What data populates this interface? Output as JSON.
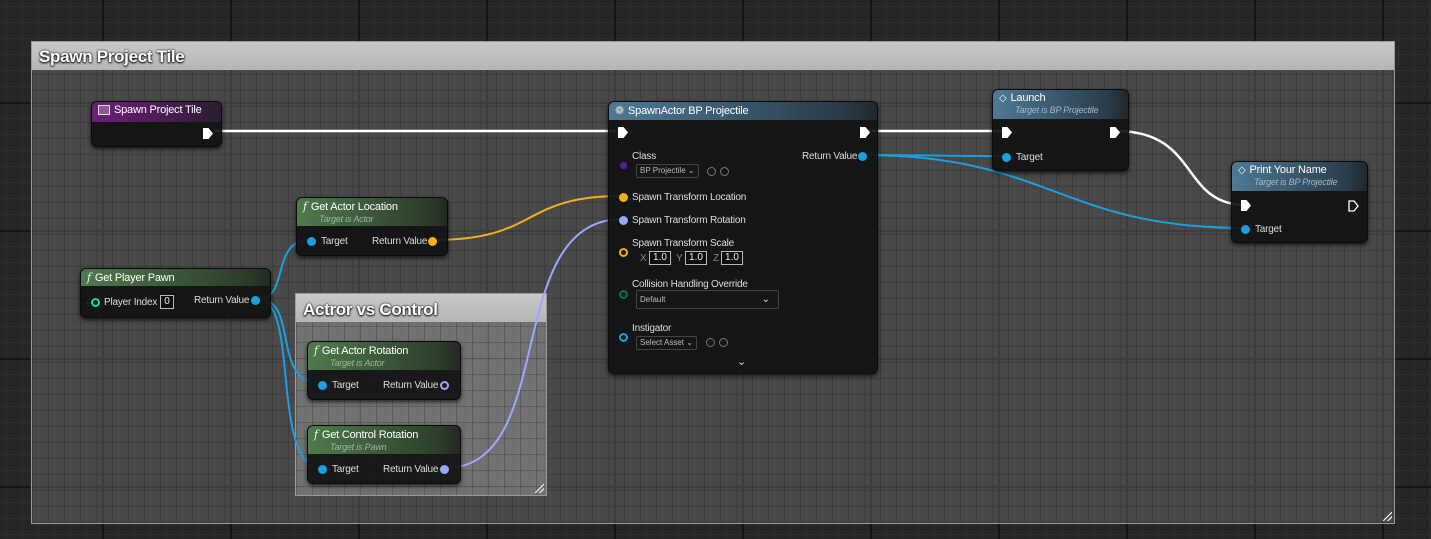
{
  "comments": {
    "main": {
      "title": "Spawn Project Tile"
    },
    "inner": {
      "title": "Actror vs Control"
    }
  },
  "nodes": {
    "event": {
      "title": "Spawn Project Tile"
    },
    "get_player_pawn": {
      "title": "Get Player Pawn",
      "player_index_label": "Player Index",
      "player_index_value": "0",
      "return_label": "Return Value"
    },
    "get_actor_location": {
      "title": "Get Actor Location",
      "subtitle": "Target is Actor",
      "target_label": "Target",
      "return_label": "Return Value"
    },
    "get_actor_rotation": {
      "title": "Get Actor Rotation",
      "subtitle": "Target is Actor",
      "target_label": "Target",
      "return_label": "Return Value"
    },
    "get_control_rotation": {
      "title": "Get Control Rotation",
      "subtitle": "Target is Pawn",
      "target_label": "Target",
      "return_label": "Return Value"
    },
    "spawn_actor": {
      "title": "SpawnActor BP Projectile",
      "class_label": "Class",
      "class_value": "BP Projectile",
      "return_label": "Return Value",
      "loc_label": "Spawn Transform Location",
      "rot_label": "Spawn Transform Rotation",
      "scale_label": "Spawn Transform Scale",
      "scale_x_label": "X",
      "scale_x": "1.0",
      "scale_y_label": "Y",
      "scale_y": "1.0",
      "scale_z_label": "Z",
      "scale_z": "1.0",
      "collision_label": "Collision Handling Override",
      "collision_value": "Default",
      "instigator_label": "Instigator",
      "instigator_value": "Select Asset"
    },
    "launch": {
      "title": "Launch",
      "subtitle": "Target is BP Projectile",
      "target_label": "Target"
    },
    "print_name": {
      "title": "Print Your Name",
      "subtitle": "Target is BP Projectile",
      "target_label": "Target"
    }
  },
  "colors": {
    "exec": "#ffffff",
    "object": "#1aa0e0",
    "vector": "#f5b014",
    "rotator": "#9ca8ff",
    "class": "#5a1f8a",
    "transform_scale": "#f5b014"
  }
}
